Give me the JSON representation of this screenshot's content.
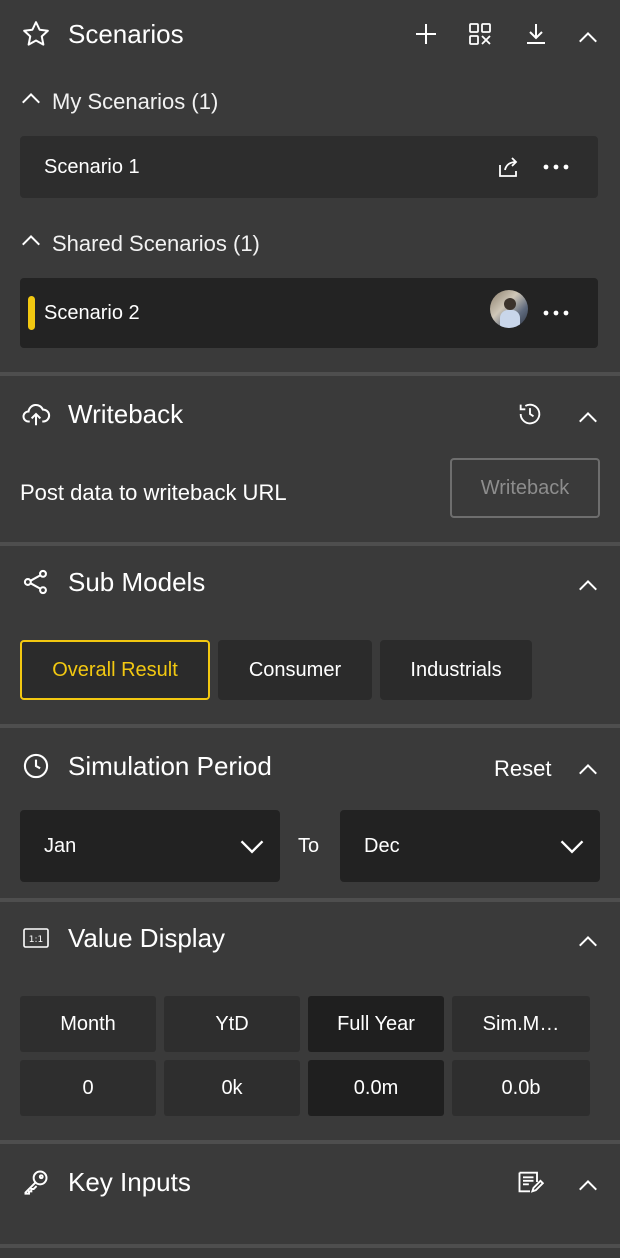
{
  "colors": {
    "accent": "#f2c811",
    "panel": "#3a3a3a",
    "card": "#2d2d2d",
    "divider": "#4e4e4e"
  },
  "scenarios": {
    "title": "Scenarios",
    "icons": [
      "star-icon",
      "plus-icon",
      "scenario-compare-icon",
      "download-icon",
      "chevron-up-icon"
    ],
    "my": {
      "label": "My Scenarios (1)",
      "items": [
        {
          "name": "Scenario 1"
        }
      ]
    },
    "shared": {
      "label": "Shared Scenarios (1)",
      "items": [
        {
          "name": "Scenario 2"
        }
      ]
    }
  },
  "writeback": {
    "title": "Writeback",
    "description": "Post data to writeback URL",
    "button_label": "Writeback"
  },
  "sub_models": {
    "title": "Sub Models",
    "options": [
      "Overall Result",
      "Consumer",
      "Industrials"
    ],
    "selected": "Overall Result"
  },
  "simulation_period": {
    "title": "Simulation Period",
    "reset_label": "Reset",
    "from": "Jan",
    "to_label": "To",
    "to": "Dec"
  },
  "value_display": {
    "title": "Value Display",
    "columns": [
      "Month",
      "YtD",
      "Full Year",
      "Sim.M…"
    ],
    "values": [
      "0",
      "0k",
      "0.0m",
      "0.0b"
    ],
    "selected": "Full Year"
  },
  "key_inputs": {
    "title": "Key Inputs"
  }
}
